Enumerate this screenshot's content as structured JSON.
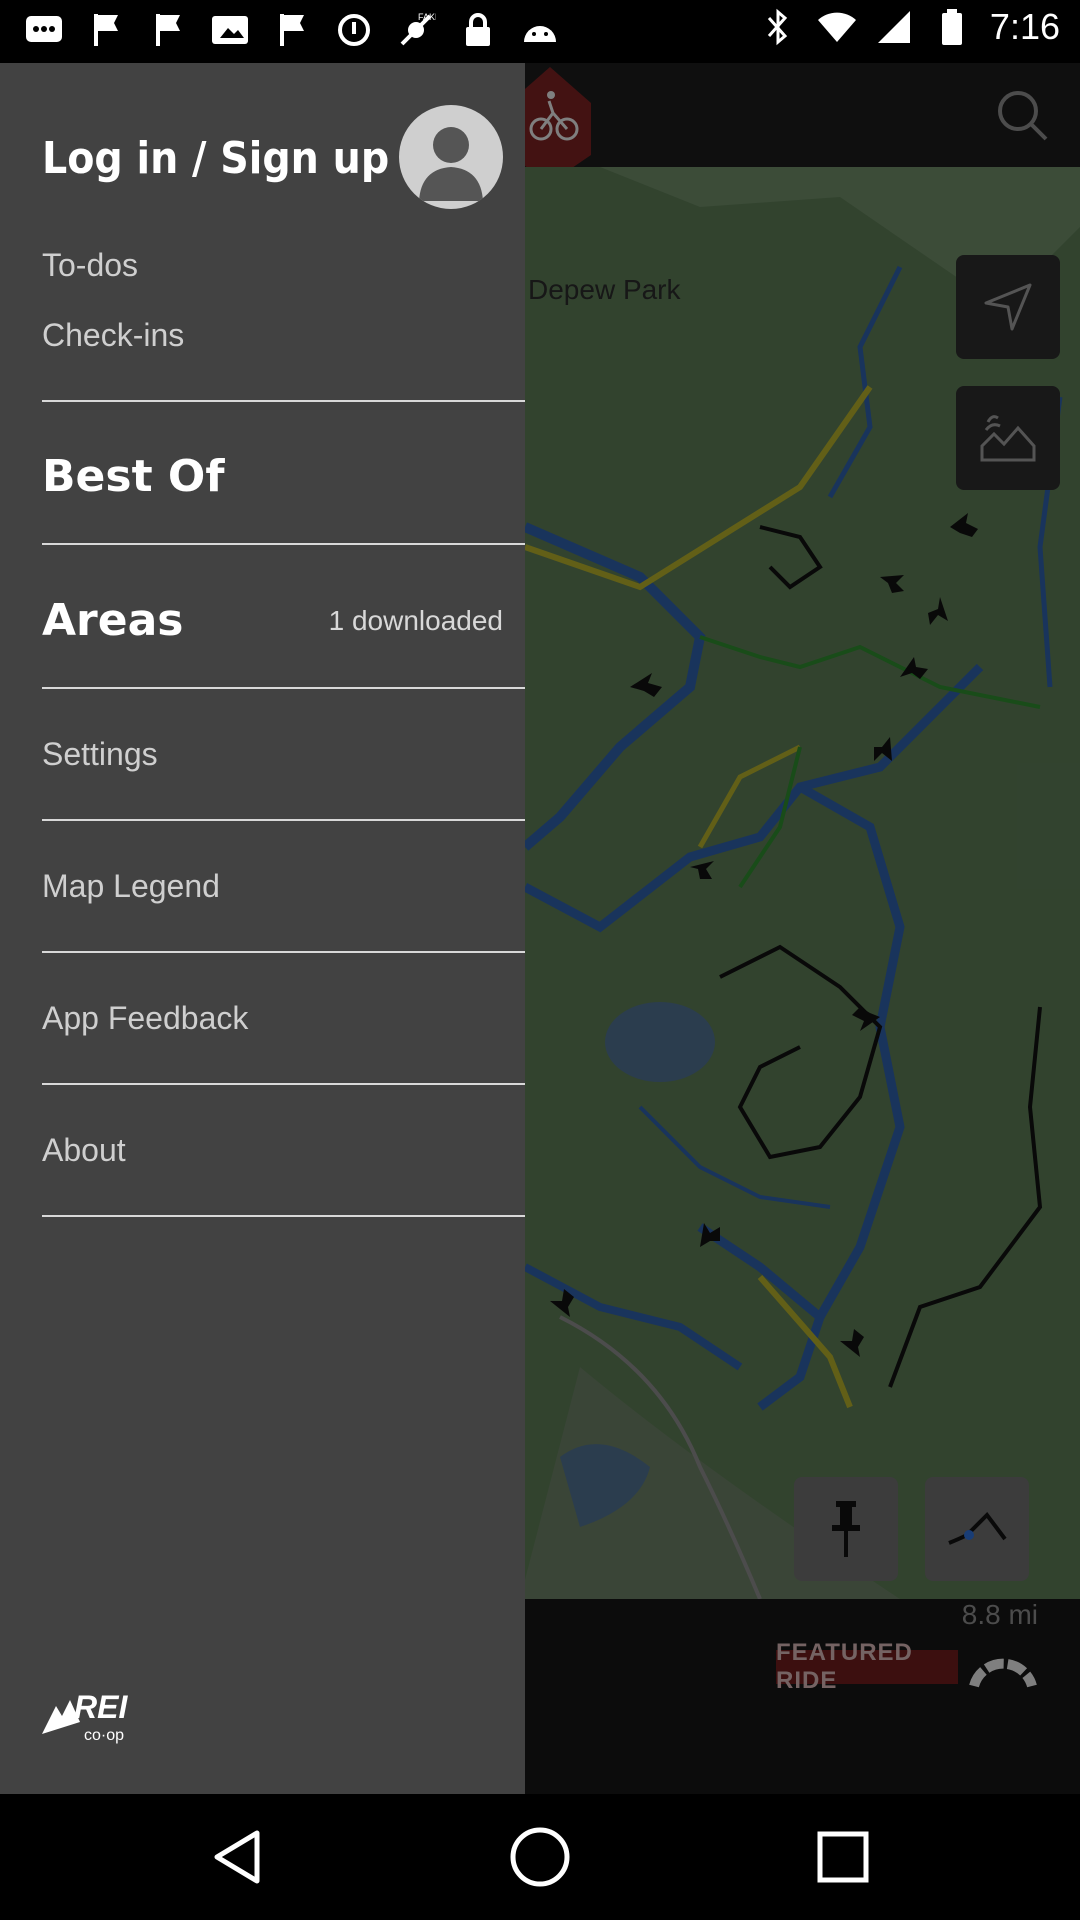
{
  "status_bar": {
    "time": "7:16",
    "icons_left": [
      "chat-icon",
      "flag-icon",
      "flag-icon",
      "slideshow-icon",
      "flag-icon",
      "sync-icon",
      "fake-gps-icon",
      "lock-icon",
      "android-icon"
    ],
    "icons_right": [
      "bluetooth-icon",
      "wifi-icon",
      "cellular-icon",
      "battery-icon"
    ]
  },
  "map": {
    "place_label": "Depew Park",
    "distance": "8.8 mi",
    "featured_label": "FEATURED RIDE",
    "colors": {
      "map_bg": "#5b7a55",
      "trail_blue": "#2f5fa8",
      "trail_yellow": "#b3ae2b",
      "trail_green": "#2f8a2f",
      "trail_black": "#111111",
      "featured_bg": "#6e1d1d"
    }
  },
  "drawer": {
    "login_label": "Log in / Sign up",
    "items_small": [
      {
        "label": "To-dos"
      },
      {
        "label": "Check-ins"
      }
    ],
    "best_of": "Best Of",
    "areas": "Areas",
    "areas_badge": "1 downloaded",
    "settings": "Settings",
    "map_legend": "Map Legend",
    "app_feedback": "App Feedback",
    "about": "About",
    "logo_text": "REI co-op"
  },
  "navbar": {
    "buttons": [
      "back-icon",
      "home-icon",
      "recents-icon"
    ]
  }
}
